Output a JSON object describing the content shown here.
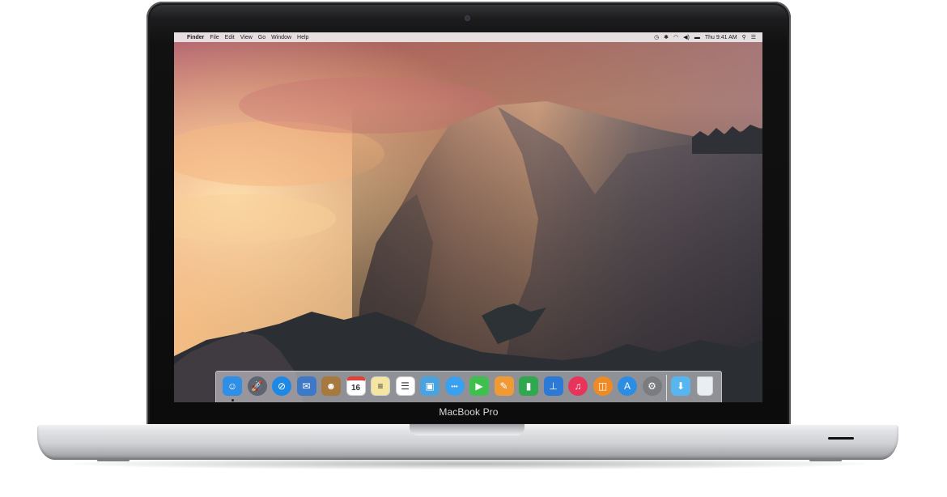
{
  "device": {
    "brand_label": "MacBook Pro"
  },
  "menubar": {
    "apple": "",
    "app": "Finder",
    "items": [
      "File",
      "Edit",
      "View",
      "Go",
      "Window",
      "Help"
    ],
    "status": {
      "clock": "Thu 9:41 AM"
    }
  },
  "dock": {
    "apps": [
      {
        "name": "Finder",
        "icon": "finder-icon",
        "color": "#2f8ee6",
        "glyph": "☺"
      },
      {
        "name": "Launchpad",
        "icon": "launchpad-icon",
        "color": "#5d6570",
        "glyph": "🚀"
      },
      {
        "name": "Safari",
        "icon": "safari-icon",
        "color": "#1e88e5",
        "glyph": "⊘"
      },
      {
        "name": "Mail",
        "icon": "mail-icon",
        "color": "#3e79c7",
        "glyph": "✉"
      },
      {
        "name": "Contacts",
        "icon": "contacts-icon",
        "color": "#a7793f",
        "glyph": "☻"
      },
      {
        "name": "Calendar",
        "icon": "calendar-icon",
        "color": "#ffffff",
        "glyph": "16"
      },
      {
        "name": "Notes",
        "icon": "notes-icon",
        "color": "#f4e6a1",
        "glyph": "≡"
      },
      {
        "name": "Reminders",
        "icon": "reminders-icon",
        "color": "#ffffff",
        "glyph": "☰"
      },
      {
        "name": "Photo Booth",
        "icon": "photos-icon",
        "color": "#4aa3df",
        "glyph": "▣"
      },
      {
        "name": "Messages",
        "icon": "messages-icon",
        "color": "#3aa0f0",
        "glyph": "•••"
      },
      {
        "name": "FaceTime",
        "icon": "facetime-icon",
        "color": "#3fc04e",
        "glyph": "▶"
      },
      {
        "name": "Pages",
        "icon": "pages-icon",
        "color": "#f09a36",
        "glyph": "✎"
      },
      {
        "name": "Numbers",
        "icon": "numbers-icon",
        "color": "#2fa84f",
        "glyph": "▮"
      },
      {
        "name": "Keynote",
        "icon": "keynote-icon",
        "color": "#2d7ad6",
        "glyph": "⊥"
      },
      {
        "name": "iTunes",
        "icon": "itunes-icon",
        "color": "#e8345a",
        "glyph": "♫"
      },
      {
        "name": "iBooks",
        "icon": "ibooks-icon",
        "color": "#f08a24",
        "glyph": "◫"
      },
      {
        "name": "App Store",
        "icon": "app-store-icon",
        "color": "#2b8de4",
        "glyph": "A"
      },
      {
        "name": "System Preferences",
        "icon": "system-preferences-icon",
        "color": "#7a7c80",
        "glyph": "⚙"
      }
    ],
    "folder": {
      "name": "Downloads",
      "icon": "downloads-folder-icon",
      "color": "#57b6ef",
      "glyph": "⬇"
    },
    "trash": {
      "name": "Trash",
      "icon": "trash-icon",
      "color": "#e9eef3",
      "glyph": ""
    }
  }
}
